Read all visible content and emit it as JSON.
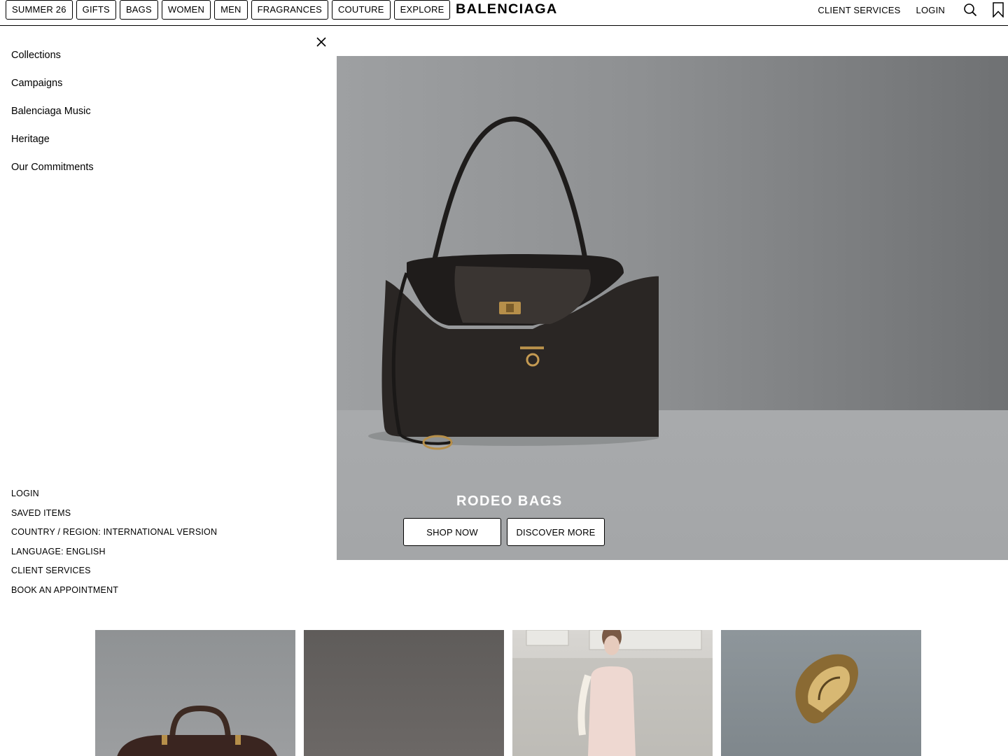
{
  "header": {
    "nav": [
      "SUMMER 26",
      "GIFTS",
      "BAGS",
      "WOMEN",
      "MEN",
      "FRAGRANCES",
      "COUTURE",
      "EXPLORE"
    ],
    "logo": "BALENCIAGA",
    "client_services": "CLIENT SERVICES",
    "login": "LOGIN",
    "icons": [
      "search-icon",
      "bookmark-icon"
    ]
  },
  "menu": {
    "items": [
      "Collections",
      "Campaigns",
      "Balenciaga Music",
      "Heritage",
      "Our Commitments"
    ],
    "secondary": [
      "LOGIN",
      "SAVED ITEMS",
      "COUNTRY / REGION: INTERNATIONAL VERSION",
      "LANGUAGE: ENGLISH",
      "CLIENT SERVICES",
      "BOOK AN APPOINTMENT"
    ]
  },
  "hero": {
    "title": "RODEO BAGS",
    "shop_now": "SHOP NOW",
    "discover_more": "DISCOVER MORE"
  }
}
